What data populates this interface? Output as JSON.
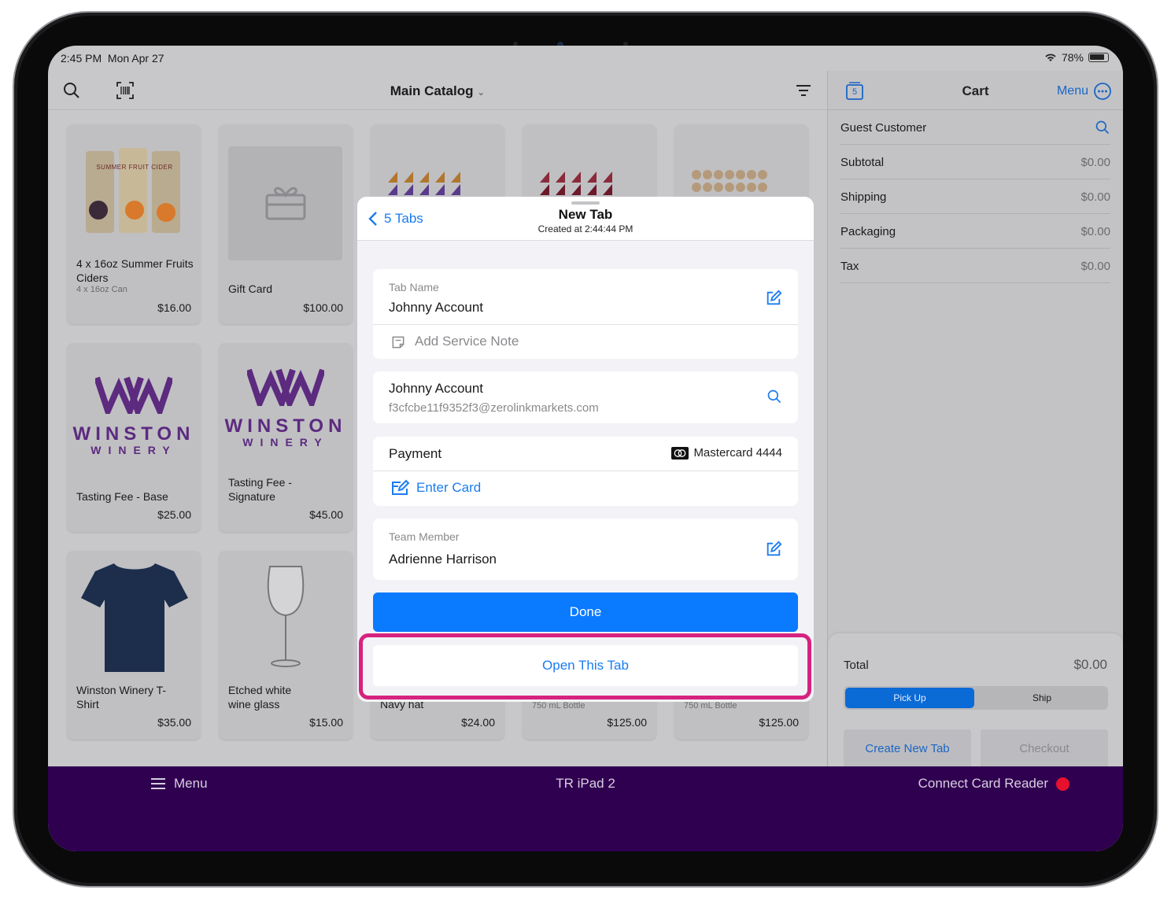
{
  "status_bar": {
    "time": "2:45 PM",
    "date": "Mon Apr 27",
    "battery": "78%"
  },
  "catalog": {
    "title": "Main Catalog",
    "products": [
      {
        "name": "4 x 16oz Summer Fruits Ciders",
        "sub": "4 x 16oz Can",
        "price": "$16.00"
      },
      {
        "name": "Gift Card",
        "sub": "",
        "price": "$100.00"
      },
      {
        "name": "",
        "sub": "",
        "price": ""
      },
      {
        "name": "",
        "sub": "",
        "price": ""
      },
      {
        "name": "",
        "sub": "",
        "price": ""
      },
      {
        "name": "Tasting Fee - Base",
        "sub": "",
        "price": "$25.00"
      },
      {
        "name": "Tasting Fee - Signature",
        "sub": "",
        "price": "$45.00"
      },
      {
        "name": "Winston Winery T-Shirt",
        "sub": "",
        "price": "$35.00"
      },
      {
        "name": "Etched white wine glass",
        "sub": "",
        "price": "$15.00"
      },
      {
        "name": "Navy hat",
        "sub": "",
        "price": "$24.00"
      },
      {
        "name": "",
        "sub": "750 mL Bottle",
        "price": "$125.00"
      },
      {
        "name": "",
        "sub": "750 mL Bottle",
        "price": "$125.00"
      }
    ],
    "cider_can_text": "SUMMER FRUIT CIDER",
    "logo_text": {
      "top": "WINSTON",
      "bottom": "WINERY"
    }
  },
  "cart": {
    "title": "Cart",
    "tab_count": "5",
    "menu_label": "Menu",
    "customer": "Guest Customer",
    "rows": [
      {
        "label": "Subtotal",
        "value": "$0.00"
      },
      {
        "label": "Shipping",
        "value": "$0.00"
      },
      {
        "label": "Packaging",
        "value": "$0.00"
      },
      {
        "label": "Tax",
        "value": "$0.00"
      }
    ],
    "total_label": "Total",
    "total_value": "$0.00",
    "fulfillment": {
      "pickup": "Pick Up",
      "ship": "Ship",
      "selected": "Pick Up"
    },
    "create_tab": "Create New Tab",
    "checkout": "Checkout"
  },
  "bottom_bar": {
    "menu": "Menu",
    "device": "TR iPad 2",
    "reader": "Connect Card Reader",
    "reader_status_color": "#e8112d"
  },
  "modal": {
    "back_label": "5 Tabs",
    "title": "New Tab",
    "subtitle": "Created at 2:44:44 PM",
    "tab_name_label": "Tab Name",
    "tab_name_value": "Johnny Account",
    "service_note_placeholder": "Add Service Note",
    "customer_name": "Johnny Account",
    "customer_email": "f3cfcbe11f9352f3@zerolinkmarkets.com",
    "payment_label": "Payment",
    "payment_card": "Mastercard 4444",
    "enter_card": "Enter Card",
    "team_member_label": "Team Member",
    "team_member_value": "Adrienne Harrison",
    "done": "Done",
    "open_tab": "Open This Tab"
  },
  "colors": {
    "accent": "#0a7aff",
    "brand": "#300050",
    "highlight": "#d6237f",
    "logo": "#5c2a7f"
  }
}
